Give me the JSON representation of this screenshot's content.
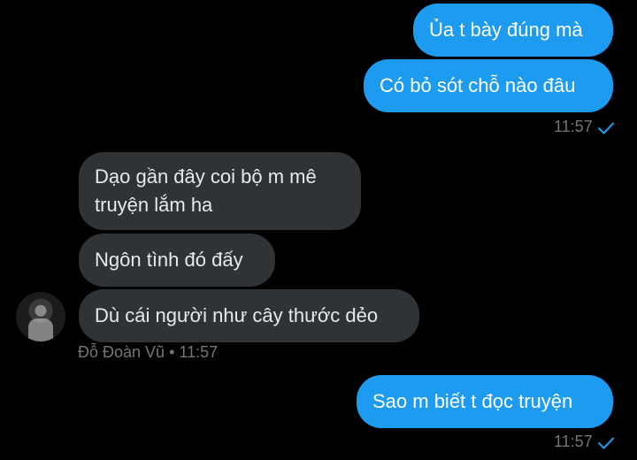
{
  "colors": {
    "background": "#000000",
    "outgoing_bubble": "#1d9bf0",
    "incoming_bubble": "#2f3336",
    "meta_text": "#71767b",
    "read_check": "#1d9bf0"
  },
  "messages": {
    "out1": {
      "text": "Ủa t bày đúng mà"
    },
    "out2": {
      "text": "Có bỏ sót chỗ nào đâu"
    },
    "out_group1_time": "11:57",
    "in1_line1": "Dạo gần đây coi bộ m mê",
    "in1_line2": "truyện lắm ha",
    "in2": {
      "text": "Ngôn tình đó đấy"
    },
    "in3": {
      "text": "Dù cái người như cây thước dẻo"
    },
    "sender": {
      "name": "Đỗ Đoàn Vũ",
      "separator": "•",
      "time": "11:57",
      "avatar_icon": "profile-photo"
    },
    "out3": {
      "text": "Sao m biết t đọc truyện"
    },
    "out_group2_time": "11:57"
  },
  "icons": {
    "read_receipt": "checkmark-icon"
  }
}
